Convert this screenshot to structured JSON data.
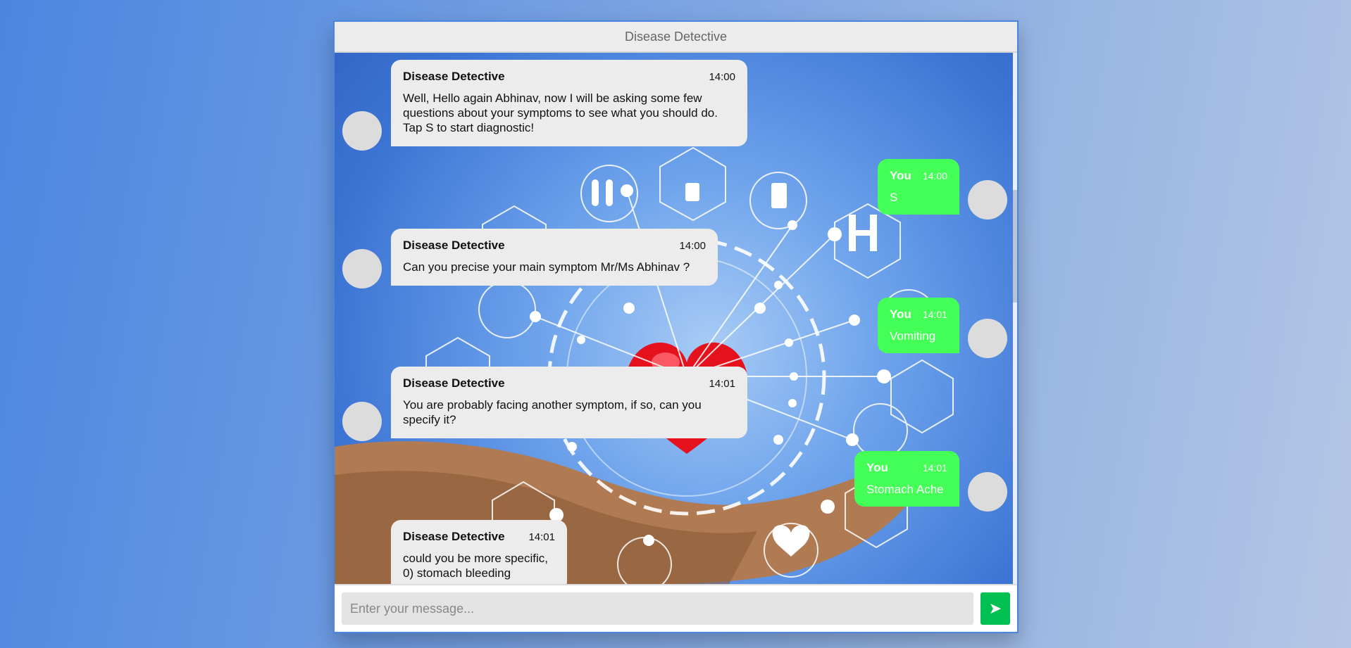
{
  "header": {
    "title": "Disease Detective"
  },
  "messages": [
    {
      "sender": "bot",
      "name": "Disease Detective",
      "time": "14:00",
      "text": "Well, Hello again Abhinav, now I will be asking some few questions about your symptoms to see what you should do. Tap S to start diagnostic!"
    },
    {
      "sender": "user",
      "name": "You",
      "time": "14:00",
      "text": "S"
    },
    {
      "sender": "bot",
      "name": "Disease Detective",
      "time": "14:00",
      "text": "Can you precise your main symptom Mr/Ms Abhinav ?"
    },
    {
      "sender": "user",
      "name": "You",
      "time": "14:01",
      "text": "Vomiting"
    },
    {
      "sender": "bot",
      "name": "Disease Detective",
      "time": "14:01",
      "text": "You are probably facing another symptom, if so, can you specify it?"
    },
    {
      "sender": "user",
      "name": "You",
      "time": "14:01",
      "text": "Stomach Ache"
    },
    {
      "sender": "bot",
      "name": "Disease Detective",
      "time": "14:01",
      "text": "could you be more specific, 0) stomach bleeding"
    }
  ],
  "composer": {
    "placeholder": "Enter your message...",
    "send_icon": "send-arrow-icon"
  },
  "colors": {
    "bot_bubble": "#ececec",
    "user_bubble": "#44ff55",
    "send_button": "#00c052",
    "frame_border": "#4a86dd"
  }
}
